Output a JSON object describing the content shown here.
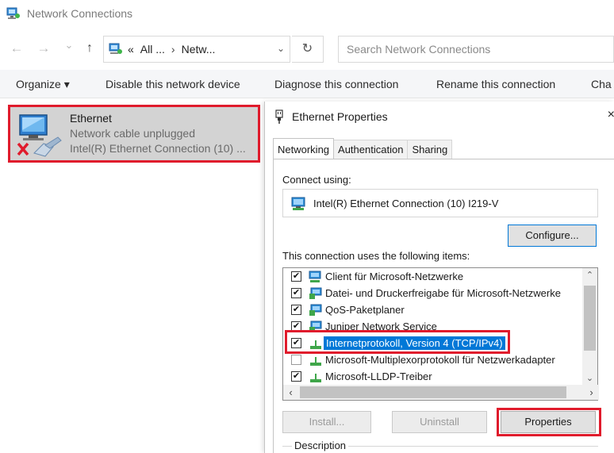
{
  "window": {
    "title": "Network Connections"
  },
  "nav": {
    "back_icon": "arrow-left-icon",
    "forward_icon": "arrow-right-icon",
    "recent_icon": "chevron-down-icon",
    "up_icon": "arrow-up-icon",
    "back_glyph": "←",
    "forward_glyph": "→",
    "recent_glyph": "⌄",
    "up_glyph": "↑",
    "address": {
      "prefix": "«",
      "crumb1": "All ...",
      "separator": "›",
      "crumb2": "Netw..."
    },
    "address_dropdown_glyph": "⌄",
    "refresh_glyph": "↻",
    "search_placeholder": "Search Network Connections"
  },
  "commandbar": {
    "organize": "Organize ▾",
    "disable": "Disable this network device",
    "diagnose": "Diagnose this connection",
    "rename": "Rename this connection",
    "change": "Cha"
  },
  "adapter": {
    "name": "Ethernet",
    "status": "Network cable unplugged",
    "device": "Intel(R) Ethernet Connection (10) ..."
  },
  "dialog": {
    "title": "Ethernet Properties",
    "close_glyph": "×",
    "tabs": [
      {
        "label": "Networking",
        "active": true
      },
      {
        "label": "Authentication",
        "active": false
      },
      {
        "label": "Sharing",
        "active": false
      }
    ],
    "connect_using_label": "Connect using:",
    "adapter_name": "Intel(R) Ethernet Connection (10) I219-V",
    "configure_button": "Configure...",
    "items_label": "This connection uses the following items:",
    "items": [
      {
        "label": "Client für Microsoft-Netzwerke",
        "checked": true,
        "icon": "network-client-icon",
        "selected": false
      },
      {
        "label": "Datei- und Druckerfreigabe für Microsoft-Netzwerke",
        "checked": true,
        "icon": "network-service-icon",
        "selected": false
      },
      {
        "label": "QoS-Paketplaner",
        "checked": true,
        "icon": "network-service-icon",
        "selected": false
      },
      {
        "label": "Juniper Network Service",
        "checked": true,
        "icon": "network-service-icon",
        "selected": false
      },
      {
        "label": "Internetprotokoll, Version 4 (TCP/IPv4)",
        "checked": true,
        "icon": "protocol-icon",
        "selected": true
      },
      {
        "label": "Microsoft-Multiplexorprotokoll für Netzwerkadapter",
        "checked": false,
        "icon": "protocol-icon",
        "selected": false
      },
      {
        "label": "Microsoft-LLDP-Treiber",
        "checked": true,
        "icon": "protocol-icon",
        "selected": false
      }
    ],
    "scroll": {
      "up_glyph": "⌃",
      "down_glyph": "⌄",
      "left_glyph": "‹",
      "right_glyph": "›"
    },
    "install_button": "Install...",
    "uninstall_button": "Uninstall",
    "properties_button": "Properties",
    "description_label": "Description",
    "check_glyph": "✔"
  },
  "colors": {
    "highlight_red": "#e01b2c",
    "selection_blue": "#0078d7"
  }
}
